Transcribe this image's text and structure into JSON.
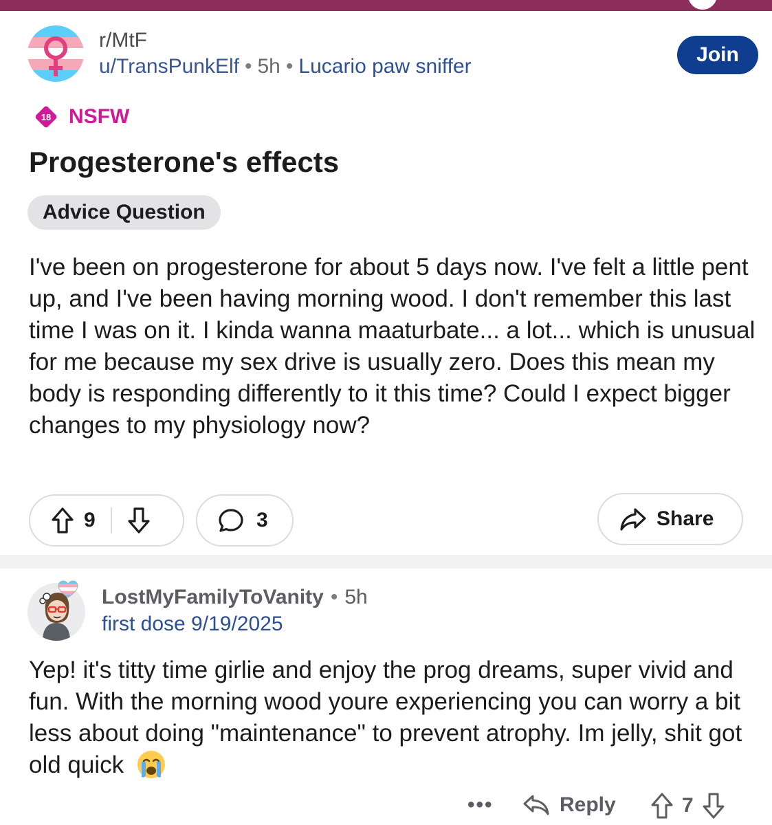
{
  "post": {
    "subreddit": "r/MtF",
    "author": "u/TransPunkElf",
    "time": "5h",
    "user_flair": "Lucario paw sniffer",
    "join_label": "Join",
    "nsfw_badge": "18",
    "nsfw_label": "NSFW",
    "title": "Progesterone's effects",
    "flair": "Advice Question",
    "body": "I've been on progesterone for about 5 days now. I've felt a little pent up, and I've been having morning wood. I don't remember this last time I was on it. I kinda wanna maaturbate... a lot... which is unusual for me because my sex drive is usually zero. Does this mean my body is responding differently to it this time? Could I expect bigger changes to my physiology now?",
    "upvotes": "9",
    "comments": "3",
    "share_label": "Share",
    "colors": {
      "top_bar": "#8c2f5c",
      "join_button": "#0f3d8f",
      "nsfw": "#d01a9a",
      "flair_link": "#2e4f95"
    }
  },
  "comment": {
    "author": "LostMyFamilyToVanity",
    "time": "5h",
    "flair": "first dose 9/19/2025",
    "body": "Yep! it's titty time girlie and enjoy the prog dreams, super vivid and fun.  With the morning wood youre experiencing you can worry a bit less about doing \"maintenance\" to prevent atrophy. Im jelly, shit got old quick",
    "emoji": "loudly-crying-face",
    "more_label": "•••",
    "reply_label": "Reply",
    "votes": "7"
  }
}
